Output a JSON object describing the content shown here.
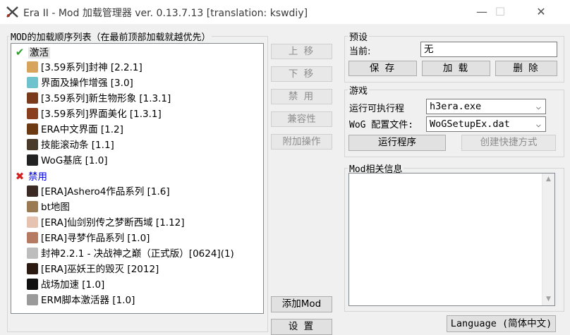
{
  "window": {
    "title": "Era II - Mod 加载管理器 ver. 0.13.7.13 [translation: kswdiy]",
    "minimize_glyph": "—",
    "maximize_glyph": "☐",
    "close_glyph": "✕"
  },
  "mod_list": {
    "group_title": "MOD的加载顺序列表（在最前顶部加载就越优先）",
    "categories": [
      {
        "label": "激活",
        "icon": "green-check-icon",
        "items": [
          {
            "label": "[3.59系列]封神 [2.2.1]",
            "icon": "feng-shen-icon",
            "color": "#d8a35a"
          },
          {
            "label": "界面及操作增强 [3.0]",
            "icon": "ui-enhance-icon",
            "color": "#6fc3cf"
          },
          {
            "label": "[3.59系列]新生物形象 [1.3.1]",
            "icon": "creature-portrait-icon",
            "color": "#7a3b1c"
          },
          {
            "label": "[3.59系列]界面美化 [1.3.1]",
            "icon": "interface-beautify-icon",
            "color": "#8a3f1f"
          },
          {
            "label": "ERA中文界面 [1.2]",
            "icon": "era-chinese-icon",
            "color": "#6b3a12"
          },
          {
            "label": "技能滚动条 [1.1]",
            "icon": "skill-scroll-icon",
            "color": "#4a3a2a"
          },
          {
            "label": "WoG基底 [1.0]",
            "icon": "wog-eye-icon",
            "color": "#222222"
          }
        ]
      },
      {
        "label": "禁用",
        "icon": "red-x-icon",
        "items": [
          {
            "label": "[ERA]Ashero4作品系列 [1.6]",
            "icon": "ashero-portrait-icon",
            "color": "#3b2a24"
          },
          {
            "label": "bt地图",
            "icon": "bt-map-icon",
            "color": "#9a7a52"
          },
          {
            "label": "[ERA]仙剑别传之梦断西域 [1.12]",
            "icon": "xianjian-icon",
            "color": "#e6c2b0"
          },
          {
            "label": "[ERA]寻梦作品系列 [1.0]",
            "icon": "xunmeng-icon",
            "color": "#b67a62"
          },
          {
            "label": "封神2.2.1 - 决战神之巅（正式版）[0624](1)",
            "icon": "folder-icon",
            "color": "#bdbdbd"
          },
          {
            "label": "[ERA]巫妖王的毁灭 [2012]",
            "icon": "lich-king-icon",
            "color": "#2a1a12"
          },
          {
            "label": "战场加速 [1.0]",
            "icon": "running-man-icon",
            "color": "#111111"
          },
          {
            "label": "ERM脚本激活器 [1.0]",
            "icon": "gear-icon",
            "color": "#9a9a9a"
          }
        ]
      }
    ]
  },
  "mid_buttons": {
    "move_up": "上 移",
    "move_down": "下 移",
    "disable": "禁 用",
    "compatibility": "兼容性",
    "extra_ops": "附加操作",
    "add_mod": "添加Mod",
    "settings": "设 置"
  },
  "preset": {
    "group_title": "预设",
    "current_label": "当前:",
    "current_value": "无",
    "save": "保 存",
    "load": "加 载",
    "delete": "删 除"
  },
  "game": {
    "group_title": "游戏",
    "exe_label": "运行可执行程",
    "exe_value": "h3era.exe",
    "config_label": "WoG 配置文件:",
    "config_value": "WoGSetupEx.dat",
    "run": "运行程序",
    "shortcut": "创建快捷方式"
  },
  "mod_info": {
    "group_title": "Mod相关信息"
  },
  "language_button": "Language (简体中文)",
  "colors": {
    "accent_blue": "#0000dd",
    "check_green": "#2e9e2e",
    "x_red": "#d21f1f"
  }
}
